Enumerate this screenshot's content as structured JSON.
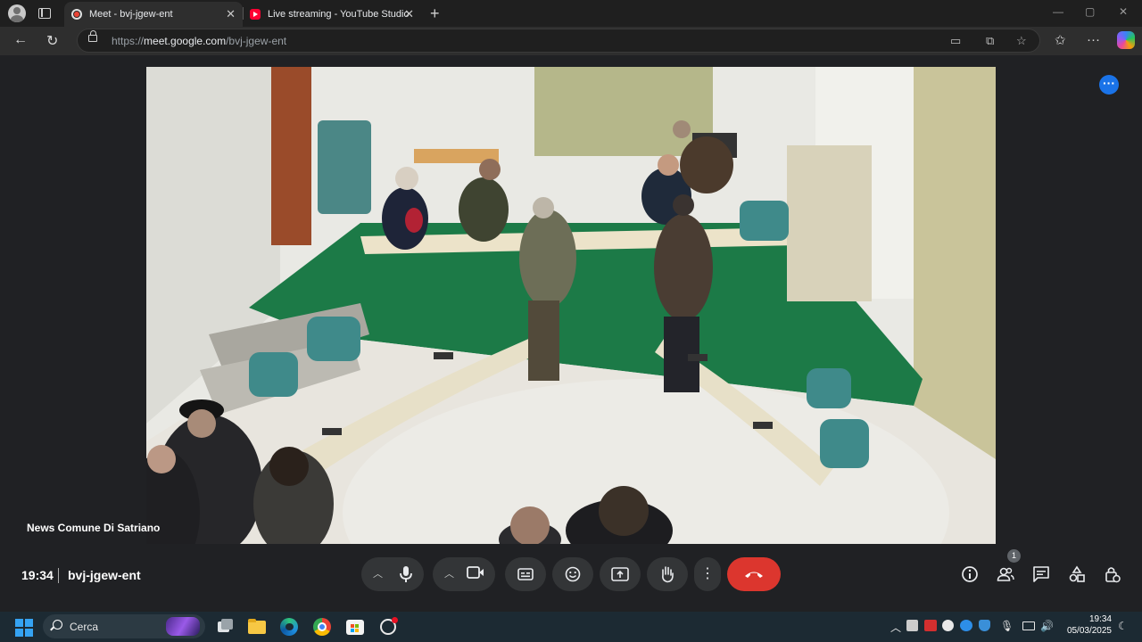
{
  "browser": {
    "tabs": [
      {
        "title": "Meet - bvj-jgew-ent",
        "active": true
      },
      {
        "title": "Live streaming - YouTube Studio",
        "active": false
      }
    ],
    "url_prefix": "https://",
    "url_host": "meet.google.com",
    "url_path": "/bvj-jgew-ent"
  },
  "meet": {
    "participant_name": "News Comune Di Satriano",
    "time": "19:34",
    "meeting_code": "bvj-jgew-ent",
    "participant_count": "1",
    "end_call_color": "#dc362e",
    "accent": "#1a73e8"
  },
  "taskbar": {
    "search_label": "Cerca",
    "clock_time": "19:34",
    "clock_date": "05/03/2025"
  }
}
